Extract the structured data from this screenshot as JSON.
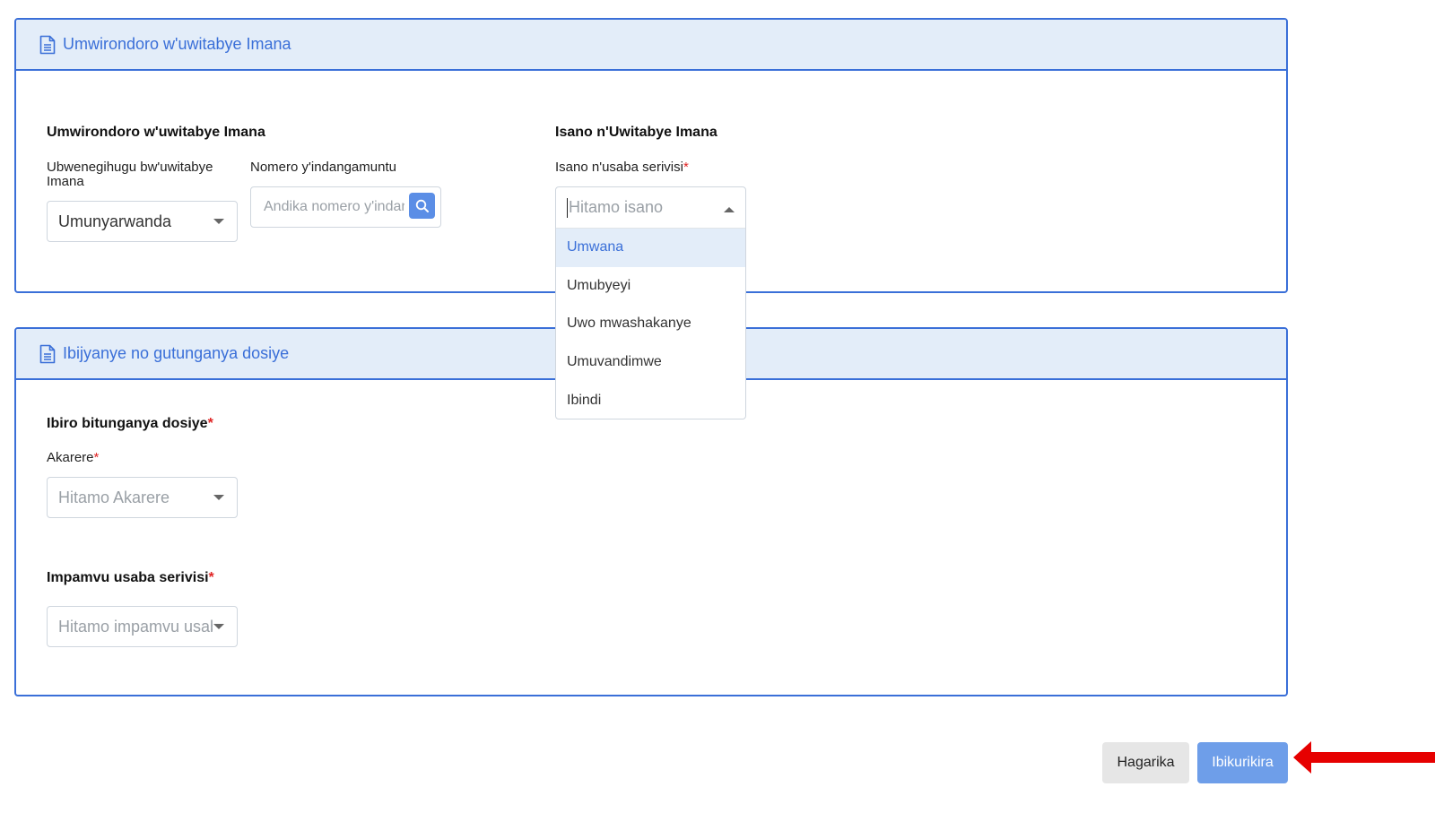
{
  "section1": {
    "header_title": "Umwirondoro w'uwitabye Imana",
    "left_title": "Umwirondoro w'uwitabye Imana",
    "nationality_label": "Ubwenegihugu bw'uwitabye Imana",
    "nationality_value": "Umunyarwanda",
    "id_label": "Nomero y'indangamuntu",
    "id_placeholder": "Andika nomero y'indangamuntu",
    "right_title": "Isano n'Uwitabye Imana",
    "relation_label": "Isano n'usaba serivisi",
    "relation_placeholder": "Hitamo isano",
    "relation_options": [
      "Umwana",
      "Umubyeyi",
      "Uwo mwashakanye",
      "Umuvandimwe",
      "Ibindi"
    ]
  },
  "section2": {
    "header_title": "Ibijyanye no gutunganya dosiye",
    "office_title": "Ibiro bitunganya dosiye",
    "district_label": "Akarere",
    "district_placeholder": "Hitamo Akarere",
    "reason_title": "Impamvu usaba serivisi",
    "reason_placeholder": "Hitamo impamvu usaba serivisi"
  },
  "actions": {
    "cancel_label": "Hagarika",
    "next_label": "Ibikurikira"
  },
  "icons": {
    "header": "document-icon",
    "search": "search-icon",
    "arrow": "red-arrow-annotation"
  },
  "colors": {
    "accent": "#3a6fd8",
    "header_bg": "#e3edf9",
    "required": "#e02424",
    "primary_button": "#6e9ee9",
    "annotation_arrow": "#e60000"
  }
}
